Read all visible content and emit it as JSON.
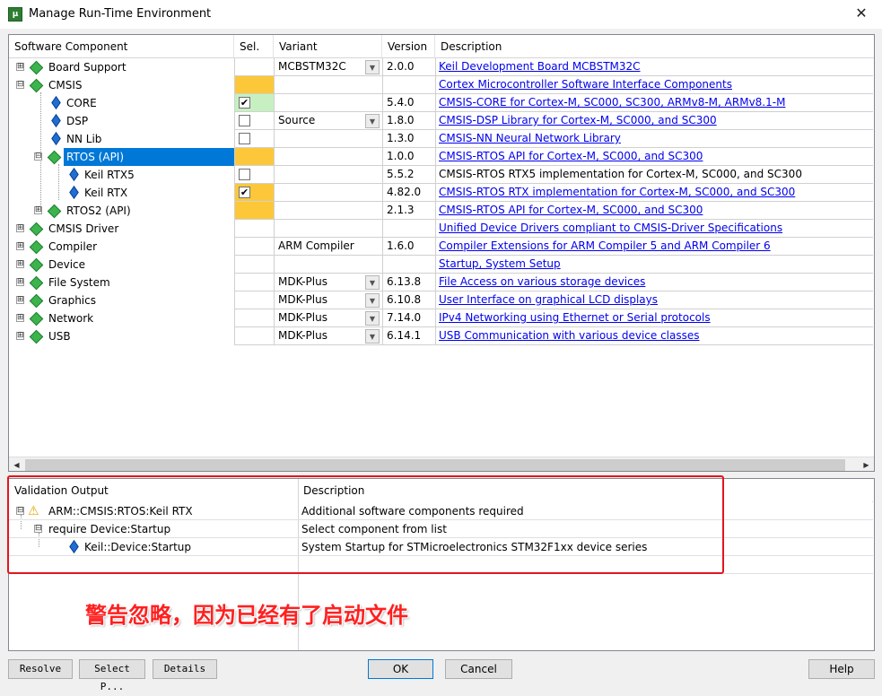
{
  "window": {
    "title": "Manage Run-Time Environment",
    "close": "✕"
  },
  "columns": {
    "component": "Software Component",
    "sel": "Sel.",
    "variant": "Variant",
    "version": "Version",
    "description": "Description"
  },
  "rows": [
    {
      "label": "Board Support",
      "variant": "MCBSTM32C",
      "version": "2.0.0",
      "desc": "Keil Development Board MCBSTM32C"
    },
    {
      "label": "CMSIS",
      "desc": "Cortex Microcontroller Software Interface Components"
    },
    {
      "label": "CORE",
      "version": "5.4.0",
      "desc": "CMSIS-CORE for Cortex-M, SC000, SC300, ARMv8-M, ARMv8.1-M",
      "check": "✔"
    },
    {
      "label": "DSP",
      "variant": "Source",
      "version": "1.8.0",
      "desc": "CMSIS-DSP Library for Cortex-M, SC000, and SC300"
    },
    {
      "label": "NN Lib",
      "version": "1.3.0",
      "desc": "CMSIS-NN Neural Network Library"
    },
    {
      "label": "RTOS (API)",
      "version": "1.0.0",
      "desc": "CMSIS-RTOS API for Cortex-M, SC000, and SC300"
    },
    {
      "label": "Keil RTX5",
      "version": "5.5.2",
      "desc": "CMSIS-RTOS RTX5 implementation for Cortex-M, SC000, and SC300"
    },
    {
      "label": "Keil RTX",
      "version": "4.82.0",
      "desc": "CMSIS-RTOS RTX implementation for Cortex-M, SC000, and SC300",
      "check": "✔"
    },
    {
      "label": "RTOS2 (API)",
      "version": "2.1.3",
      "desc": "CMSIS-RTOS API for Cortex-M, SC000, and SC300"
    },
    {
      "label": "CMSIS Driver",
      "desc": "Unified Device Drivers compliant to CMSIS-Driver Specifications"
    },
    {
      "label": "Compiler",
      "variant": "ARM Compiler",
      "version": "1.6.0",
      "desc": "Compiler Extensions for ARM Compiler 5 and ARM Compiler 6"
    },
    {
      "label": "Device",
      "desc": "Startup, System Setup"
    },
    {
      "label": "File System",
      "variant": "MDK-Plus",
      "version": "6.13.8",
      "desc": "File Access on various storage devices"
    },
    {
      "label": "Graphics",
      "variant": "MDK-Plus",
      "version": "6.10.8",
      "desc": "User Interface on graphical LCD displays"
    },
    {
      "label": "Network",
      "variant": "MDK-Plus",
      "version": "7.14.0",
      "desc": "IPv4 Networking using Ethernet or Serial protocols"
    },
    {
      "label": "USB",
      "variant": "MDK-Plus",
      "version": "6.14.1",
      "desc": "USB Communication with various device classes"
    }
  ],
  "validation": {
    "col_output": "Validation Output",
    "col_desc": "Description",
    "rows": [
      {
        "label": "ARM::CMSIS:RTOS:Keil RTX",
        "desc": "Additional software components required"
      },
      {
        "label": "require Device:Startup",
        "desc": "Select component from list"
      },
      {
        "label": "Keil::Device:Startup",
        "desc": "System Startup for STMicroelectronics STM32F1xx device series"
      }
    ]
  },
  "annotation": "警告忽略，因为已经有了启动文件",
  "buttons": {
    "resolve": "Resolve",
    "select": "Select P...",
    "details": "Details",
    "ok": "OK",
    "cancel": "Cancel",
    "help": "Help"
  },
  "colors": {
    "selection": "#0078d7",
    "conflict": "#fcc83a",
    "resolved": "#c6f0c1",
    "link": "#0000ee",
    "annotation_box": "#e5141e"
  },
  "icons": {
    "expand": "⊞",
    "collapse": "⊟",
    "warning": "⚠"
  }
}
